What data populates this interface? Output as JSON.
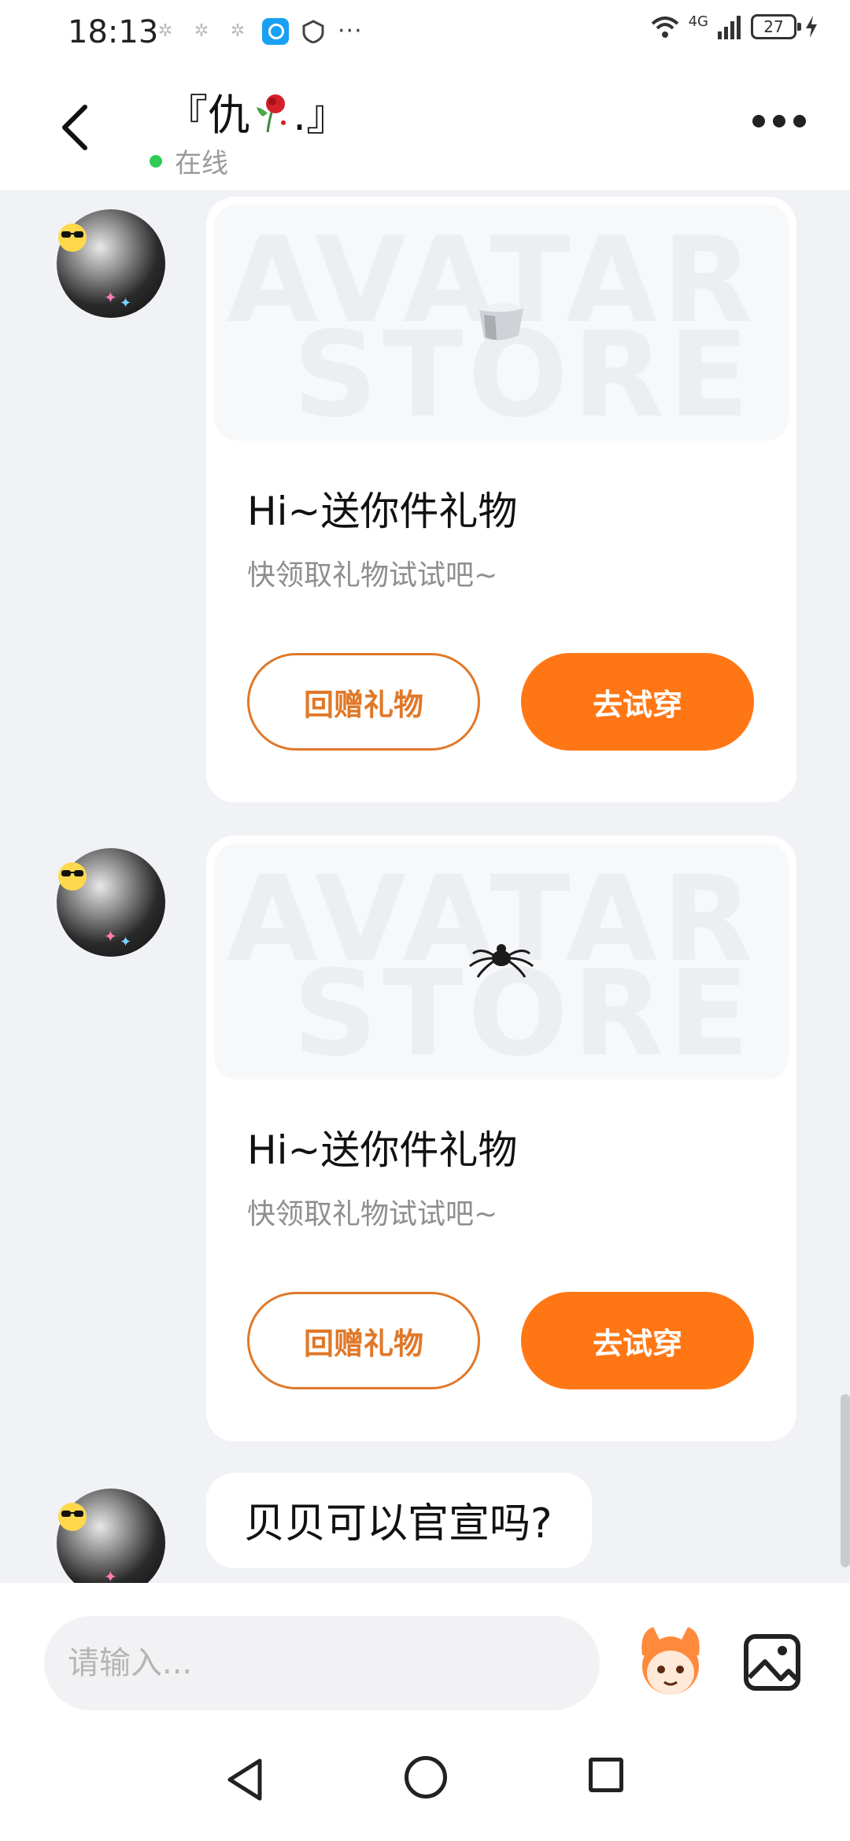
{
  "status_bar": {
    "time": "18:13",
    "network": "4G",
    "battery": "27"
  },
  "header": {
    "title_prefix": "『仇",
    "title_suffix": ".』",
    "status": "在线"
  },
  "messages": [
    {
      "type": "gift",
      "title": "Hi~送你件礼物",
      "subtitle": "快领取礼物试试吧~",
      "return_label": "回赠礼物",
      "try_label": "去试穿",
      "watermark": [
        "AVATAR",
        "STORE"
      ]
    },
    {
      "type": "gift",
      "title": "Hi~送你件礼物",
      "subtitle": "快领取礼物试试吧~",
      "return_label": "回赠礼物",
      "try_label": "去试穿",
      "watermark": [
        "AVATAR",
        "STORE"
      ]
    },
    {
      "type": "text",
      "text": "贝贝可以官宣吗?"
    }
  ],
  "input": {
    "placeholder": "请输入..."
  },
  "colors": {
    "accent": "#ff7714",
    "outline": "#e07829",
    "online": "#2ecc55",
    "background": "#f1f2f6"
  }
}
